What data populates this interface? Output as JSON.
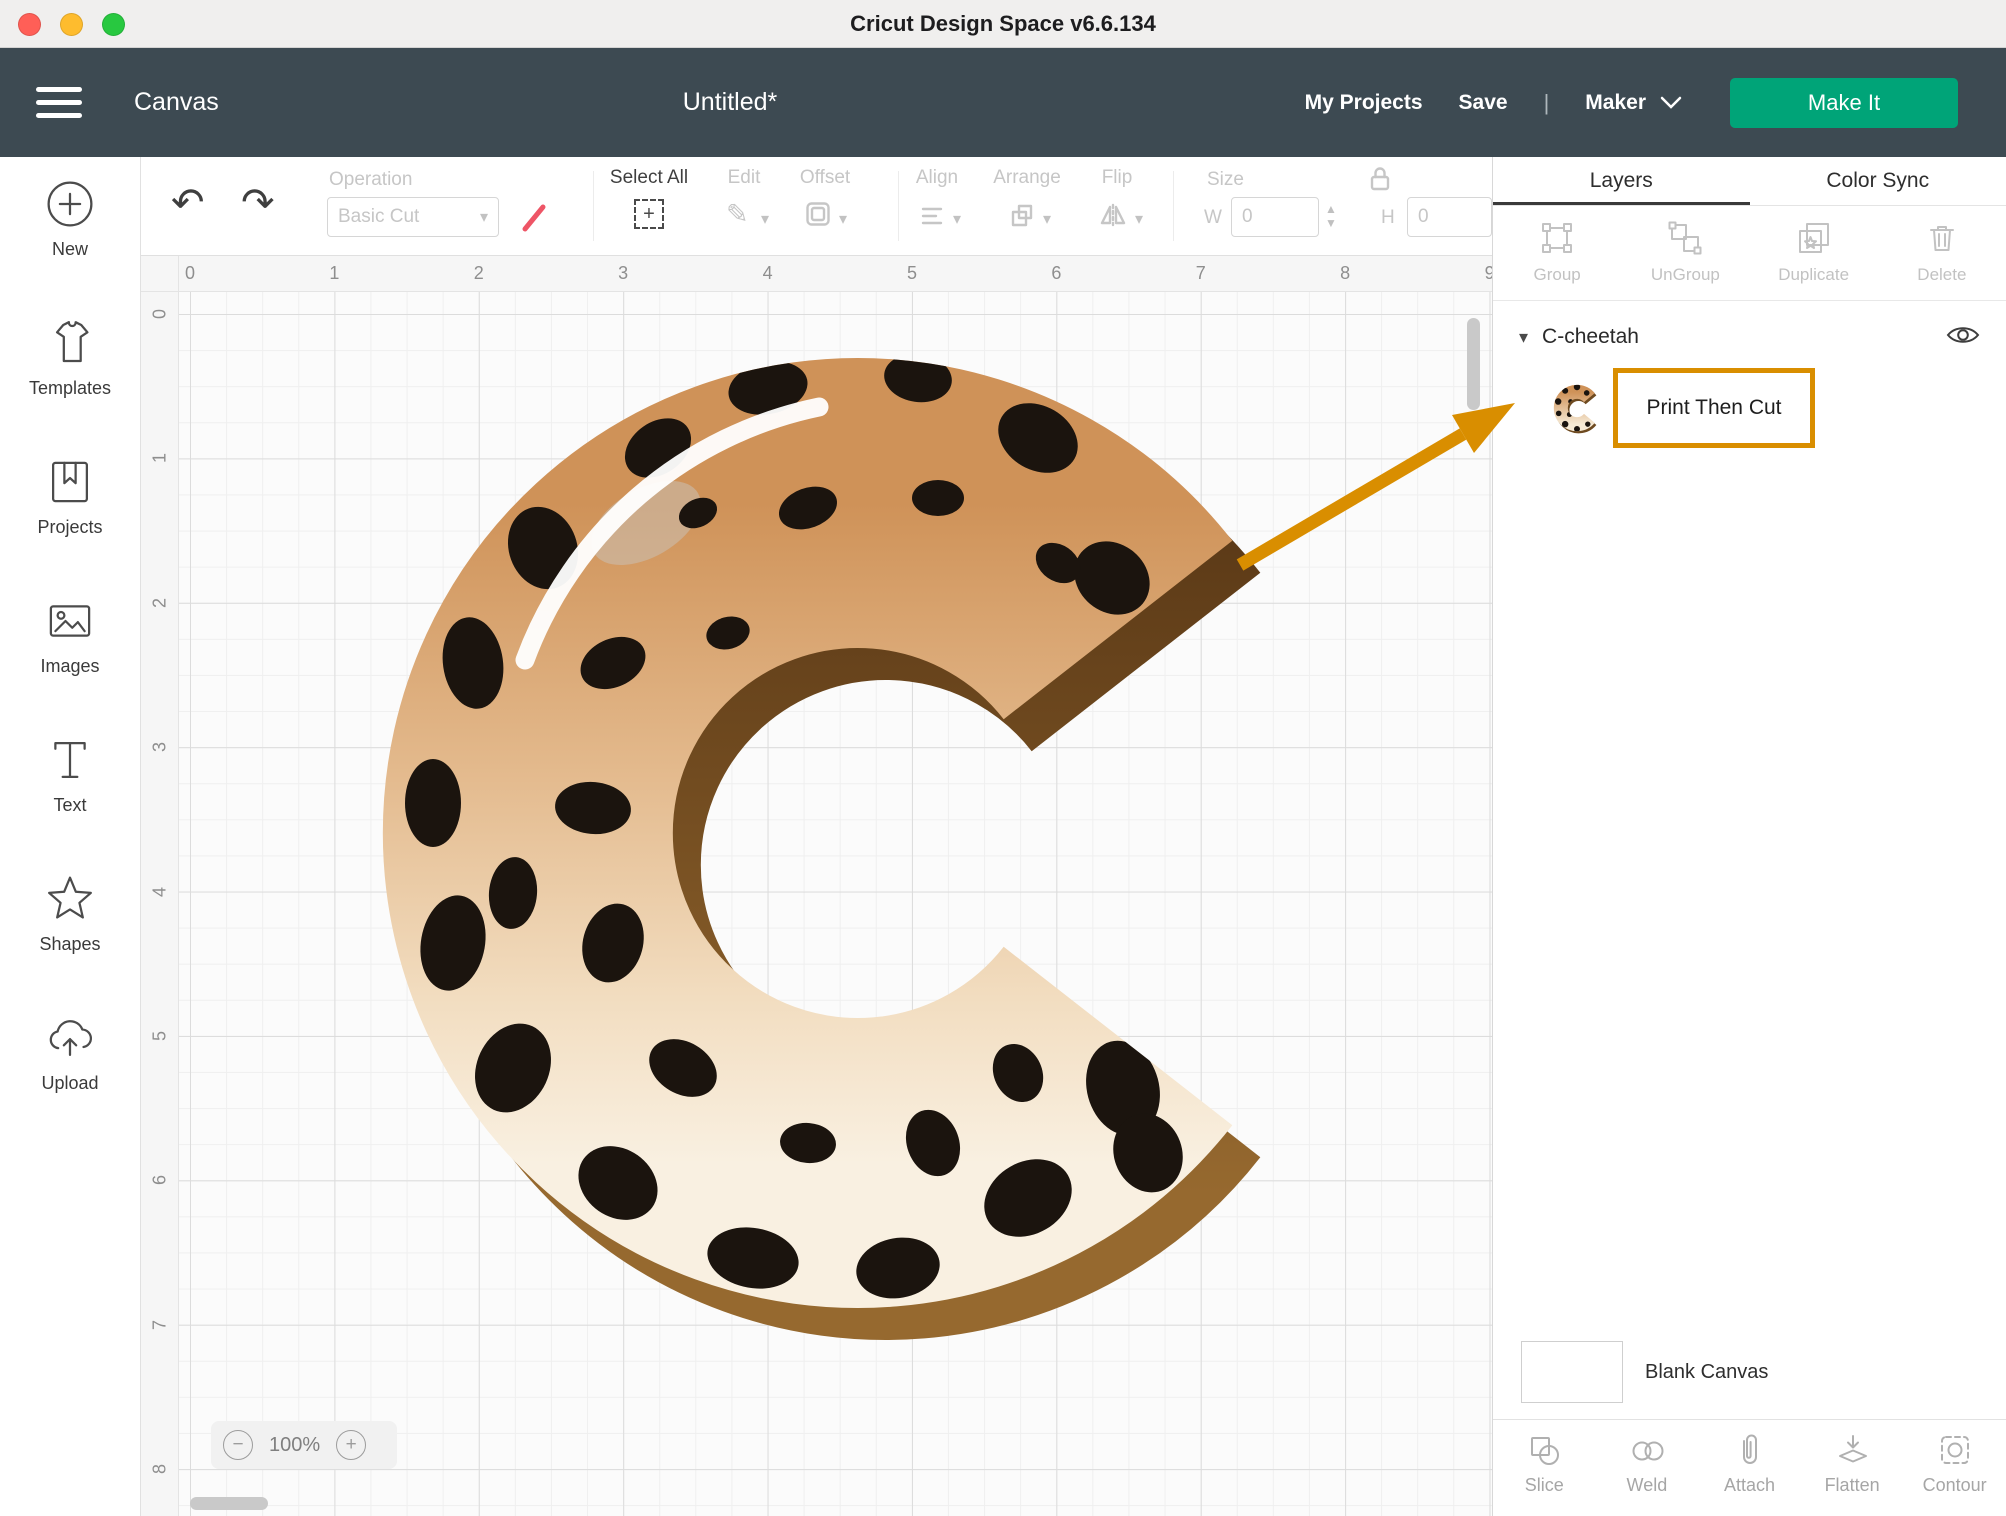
{
  "titlebar": {
    "title": "Cricut Design Space  v6.6.134"
  },
  "nav": {
    "canvas_label": "Canvas",
    "doc_title": "Untitled*",
    "my_projects": "My Projects",
    "save": "Save",
    "divider": "|",
    "machine": "Maker",
    "make_it": "Make It"
  },
  "sidebar": {
    "items": [
      {
        "label": "New"
      },
      {
        "label": "Templates"
      },
      {
        "label": "Projects"
      },
      {
        "label": "Images"
      },
      {
        "label": "Text"
      },
      {
        "label": "Shapes"
      },
      {
        "label": "Upload"
      }
    ]
  },
  "toolbar": {
    "operation_label": "Operation",
    "operation_value": "Basic Cut",
    "select_all": "Select All",
    "edit": "Edit",
    "offset": "Offset",
    "align": "Align",
    "arrange": "Arrange",
    "flip": "Flip",
    "size_label": "Size",
    "w_label": "W",
    "w_value": "0",
    "h_label": "H",
    "h_value": "0"
  },
  "rulers": {
    "h": [
      "0",
      "1",
      "2",
      "3",
      "4",
      "5",
      "6",
      "7",
      "8",
      "9"
    ],
    "v": [
      "0",
      "1",
      "2",
      "3",
      "4",
      "5",
      "6",
      "7",
      "8"
    ]
  },
  "canvas": {
    "zoom_out": "−",
    "zoom_level": "100%",
    "zoom_in": "+",
    "artwork_description": "cheetah-print letter C"
  },
  "layers": {
    "tab_layers": "Layers",
    "tab_color_sync": "Color Sync",
    "actions": [
      {
        "label": "Group"
      },
      {
        "label": "UnGroup"
      },
      {
        "label": "Duplicate"
      },
      {
        "label": "Delete"
      }
    ],
    "group_name": "C-cheetah",
    "layer_operation": "Print Then Cut",
    "blank_canvas_label": "Blank Canvas",
    "bottom_actions": [
      {
        "label": "Slice"
      },
      {
        "label": "Weld"
      },
      {
        "label": "Attach"
      },
      {
        "label": "Flatten"
      },
      {
        "label": "Contour"
      }
    ]
  },
  "colors": {
    "accent_green": "#00a478",
    "highlight_orange": "#D98E00",
    "nav_dark": "#3d4a52"
  }
}
